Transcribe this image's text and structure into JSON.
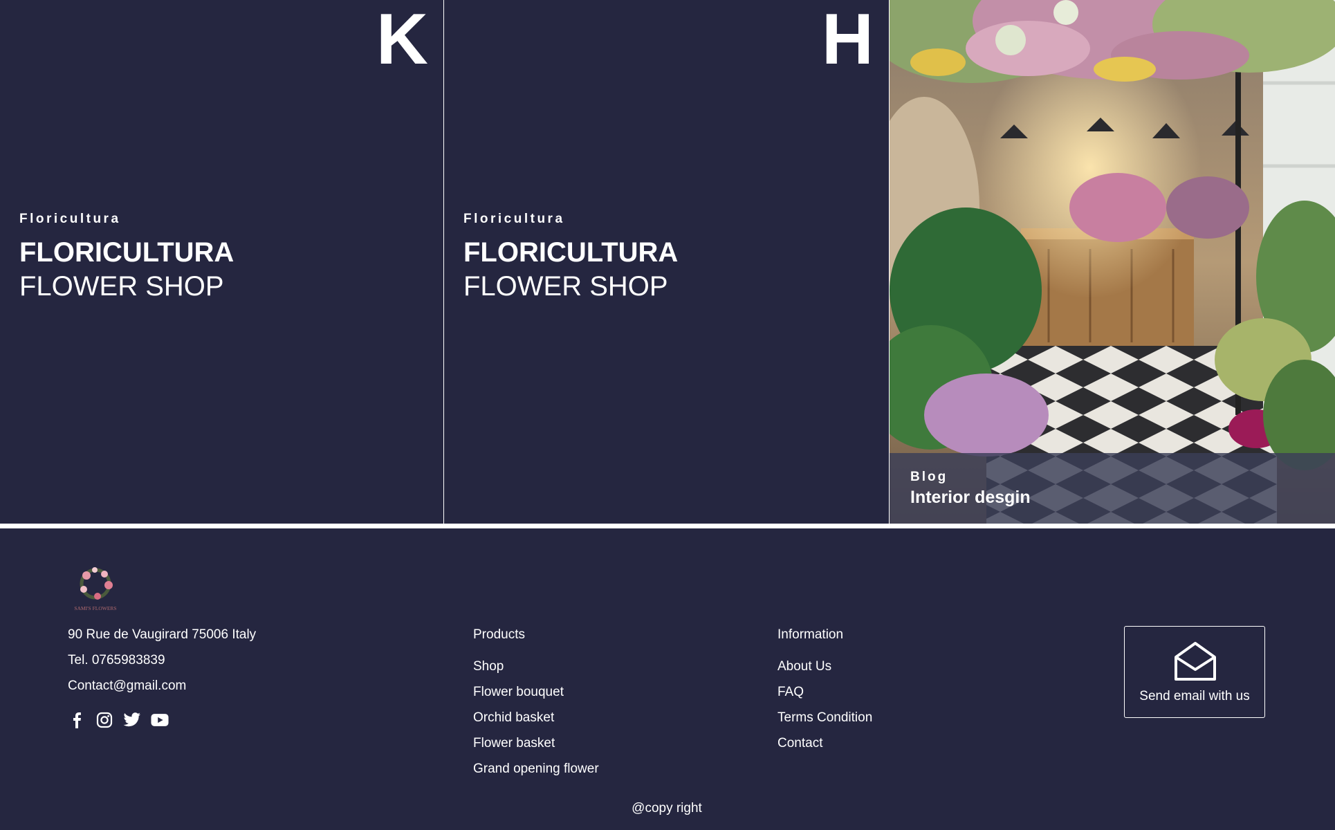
{
  "cards": [
    {
      "letter": "K",
      "eyebrow": "Floricultura",
      "title": "FLORICULTURA",
      "subtitle": "FLOWER SHOP"
    },
    {
      "letter": "H",
      "eyebrow": "Floricultura",
      "title": "FLORICULTURA",
      "subtitle": "FLOWER SHOP"
    }
  ],
  "blog": {
    "eyebrow": "Blog",
    "title": "Interior desgin",
    "image": "flower-shop-interior-photo"
  },
  "footer": {
    "logo": "sams-flowers-wreath-logo",
    "address": "90 Rue de Vaugirard 75006 Italy",
    "tel": "Tel. 0765983839",
    "email": "Contact@gmail.com",
    "socials": [
      "facebook-icon",
      "instagram-icon",
      "twitter-icon",
      "youtube-icon"
    ],
    "products": {
      "heading": "Products",
      "links": [
        "Shop",
        "Flower bouquet",
        "Orchid basket",
        "Flower basket",
        "Grand opening flower"
      ]
    },
    "information": {
      "heading": "Information",
      "links": [
        "About Us",
        "FAQ",
        "Terms Condition",
        "Contact"
      ]
    },
    "email_button": {
      "label": "Send email with us",
      "icon": "envelope-open-icon"
    },
    "copyright": "@copy right"
  },
  "colors": {
    "navy": "#252640",
    "white": "#ffffff",
    "blog_overlay": "#3a3e58"
  }
}
